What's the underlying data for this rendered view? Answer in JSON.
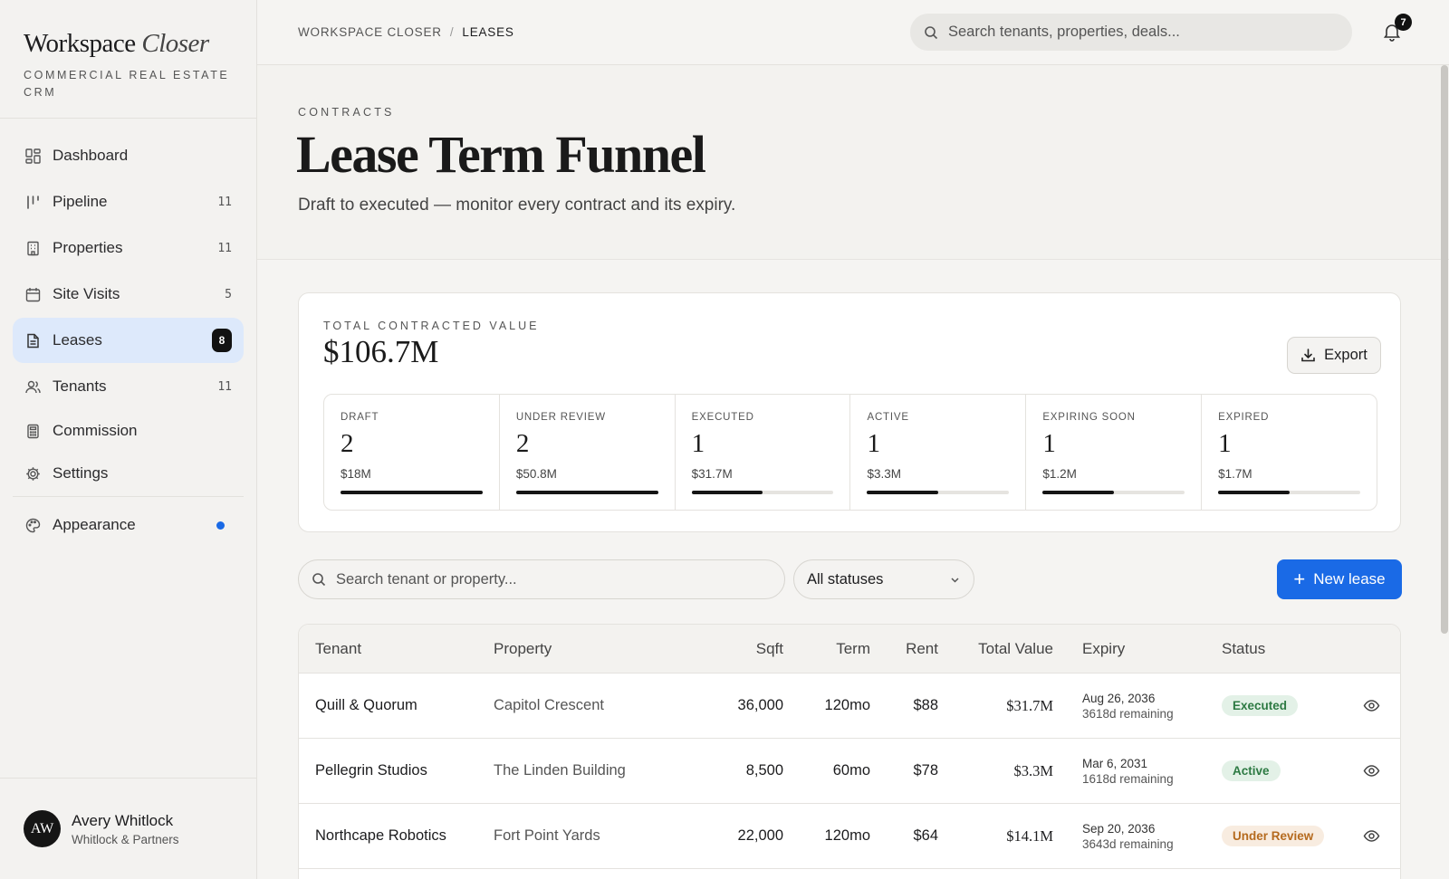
{
  "brand": {
    "name_regular": "Workspace",
    "name_italic": "Closer",
    "subtitle": "COMMERCIAL REAL ESTATE CRM"
  },
  "nav": [
    {
      "label": "Dashboard",
      "count": "",
      "icon": "dashboard-icon"
    },
    {
      "label": "Pipeline",
      "count": "11",
      "icon": "pipeline-icon"
    },
    {
      "label": "Properties",
      "count": "11",
      "icon": "building-icon"
    },
    {
      "label": "Site Visits",
      "count": "5",
      "icon": "calendar-icon"
    },
    {
      "label": "Leases",
      "count": "8",
      "icon": "document-icon",
      "active": true
    },
    {
      "label": "Tenants",
      "count": "11",
      "icon": "users-icon"
    },
    {
      "label": "Commission",
      "count": "",
      "icon": "calculator-icon"
    },
    {
      "label": "Settings",
      "count": "",
      "icon": "gear-icon"
    }
  ],
  "appearance": {
    "label": "Appearance",
    "icon": "palette-icon",
    "accent": "#1a6ae6"
  },
  "user": {
    "initials": "AW",
    "name": "Avery Whitlock",
    "org": "Whitlock & Partners"
  },
  "topbar": {
    "crumbs": [
      "WORKSPACE CLOSER",
      "LEASES"
    ],
    "search_placeholder": "Search tenants, properties, deals...",
    "notifications": "7"
  },
  "hero": {
    "eyebrow": "CONTRACTS",
    "title": "Lease Term Funnel",
    "subtitle": "Draft to executed — monitor every contract and its expiry."
  },
  "summary": {
    "label": "TOTAL CONTRACTED VALUE",
    "total": "$106.7M",
    "export_label": "Export",
    "stages": [
      {
        "name": "Draft",
        "count": "2",
        "value": "$18M",
        "fill": 1.0
      },
      {
        "name": "Under Review",
        "count": "2",
        "value": "$50.8M",
        "fill": 1.0
      },
      {
        "name": "Executed",
        "count": "1",
        "value": "$31.7M",
        "fill": 0.5
      },
      {
        "name": "Active",
        "count": "1",
        "value": "$3.3M",
        "fill": 0.5
      },
      {
        "name": "Expiring Soon",
        "count": "1",
        "value": "$1.2M",
        "fill": 0.5
      },
      {
        "name": "Expired",
        "count": "1",
        "value": "$1.7M",
        "fill": 0.5
      }
    ]
  },
  "filters": {
    "search_placeholder": "Search tenant or property...",
    "status_value": "All statuses",
    "new_label": "New lease"
  },
  "table": {
    "headers": {
      "tenant": "Tenant",
      "property": "Property",
      "sqft": "Sqft",
      "term": "Term",
      "rent": "Rent",
      "total": "Total Value",
      "expiry": "Expiry",
      "status": "Status"
    },
    "rows": [
      {
        "tenant": "Quill & Quorum",
        "property": "Capitol Crescent",
        "sqft": "36,000",
        "term": "120mo",
        "rent": "$88",
        "total": "$31.7M",
        "expiry": "Aug 26, 2036",
        "remaining": "3618d remaining",
        "status": "Executed",
        "status_class": "executed"
      },
      {
        "tenant": "Pellegrin Studios",
        "property": "The Linden Building",
        "sqft": "8,500",
        "term": "60mo",
        "rent": "$78",
        "total": "$3.3M",
        "expiry": "Mar 6, 2031",
        "remaining": "1618d remaining",
        "status": "Active",
        "status_class": "active"
      },
      {
        "tenant": "Northcape Robotics",
        "property": "Fort Point Yards",
        "sqft": "22,000",
        "term": "120mo",
        "rent": "$64",
        "total": "$14.1M",
        "expiry": "Sep 20, 2036",
        "remaining": "3643d remaining",
        "status": "Under Review",
        "status_class": "review"
      }
    ]
  }
}
